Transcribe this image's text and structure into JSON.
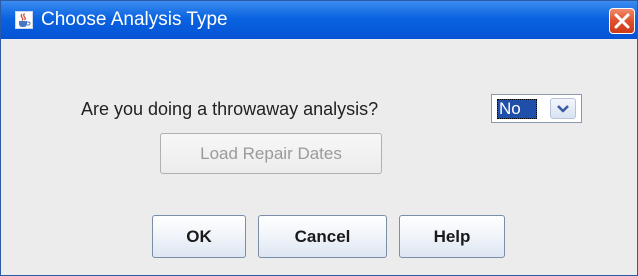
{
  "window": {
    "title": "Choose Analysis Type",
    "app_icon": "java-cup-icon",
    "close_icon": "close-icon"
  },
  "form": {
    "question": "Are you doing a throwaway analysis?",
    "throwaway_select": {
      "selected_value": "No",
      "arrow_icon": "chevron-down-icon"
    },
    "load_repair_dates_label": "Load Repair Dates",
    "load_repair_dates_enabled": false
  },
  "buttons": {
    "ok_label": "OK",
    "cancel_label": "Cancel",
    "help_label": "Help"
  },
  "colors": {
    "titlebar": "#0a63e0",
    "selection": "#1f4fa8",
    "close_button": "#e0502a"
  }
}
